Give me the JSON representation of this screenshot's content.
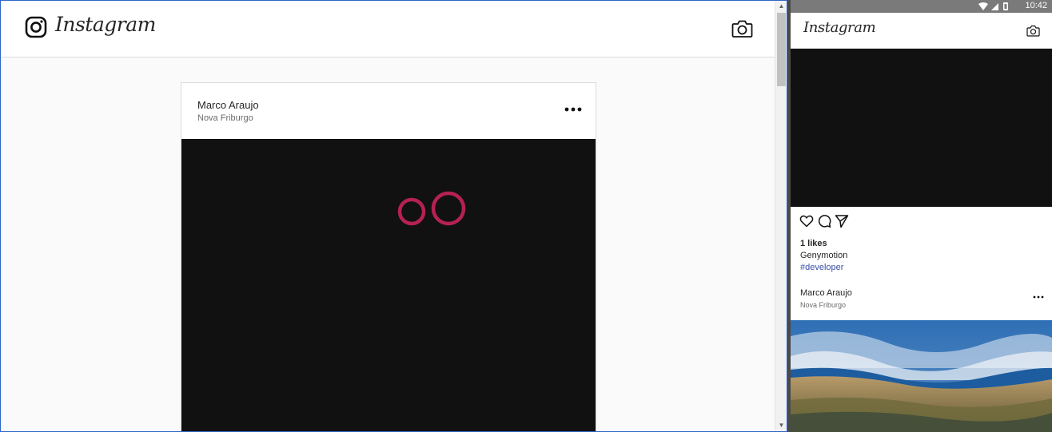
{
  "desktop": {
    "header": {
      "wordmark": "Instagram",
      "logo_icon": "instagram-glyph-icon",
      "camera_icon": "camera-icon"
    },
    "post": {
      "username": "Marco Araujo",
      "location": "Nova Friburgo",
      "more_icon": "more-horizontal-icon",
      "image_description_colors": {
        "background": "#111111",
        "rings": "#c8235a"
      }
    }
  },
  "phone": {
    "status_bar": {
      "time": "10:42",
      "icons": [
        "wifi-icon",
        "signal-icon",
        "battery-icon"
      ]
    },
    "header": {
      "wordmark": "Instagram",
      "camera_icon": "camera-icon"
    },
    "feed_post": {
      "action_icons": [
        "heart-icon",
        "comment-icon",
        "share-icon"
      ],
      "likes": "1 likes",
      "caption": "Genymotion",
      "hashtag": "#developer"
    },
    "next_post": {
      "username": "Marco Araujo",
      "location": "Nova Friburgo",
      "more_icon": "more-horizontal-icon"
    }
  },
  "colors": {
    "accent_link": "#3b4fa8",
    "border": "#dbdbdb",
    "background": "#fafafa"
  }
}
